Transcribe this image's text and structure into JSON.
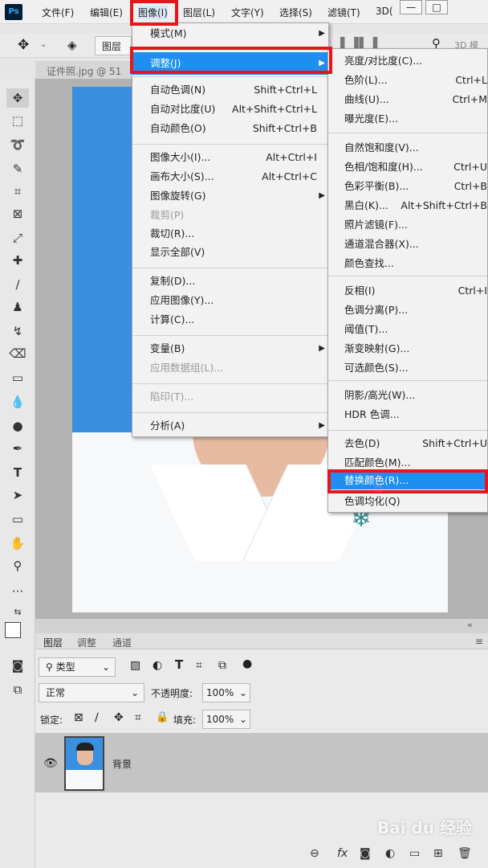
{
  "app": {
    "logo": "Ps"
  },
  "menubar": {
    "file": "文件(F)",
    "edit": "编辑(E)",
    "image": "图像(I)",
    "layer": "图层(L)",
    "type": "文字(Y)",
    "select": "选择(S)",
    "filter": "滤镜(T)",
    "view3d": "3D("
  },
  "window_controls": {
    "minimize": "—",
    "maximize": "□"
  },
  "options_bar": {
    "layer_dropdown": "图层",
    "mode3d": "3D 模"
  },
  "document_tab": {
    "title": "证件照.jpg @ 51"
  },
  "image_menu": {
    "items": [
      {
        "label": "模式(M)",
        "shortcut": "",
        "submenu": true,
        "disabled": false
      },
      {
        "label": "调整(J)",
        "shortcut": "",
        "submenu": true,
        "disabled": false,
        "highlighted": true
      },
      {
        "label": "自动色调(N)",
        "shortcut": "Shift+Ctrl+L",
        "submenu": false,
        "disabled": false
      },
      {
        "label": "自动对比度(U)",
        "shortcut": "Alt+Shift+Ctrl+L",
        "submenu": false,
        "disabled": false
      },
      {
        "label": "自动颜色(O)",
        "shortcut": "Shift+Ctrl+B",
        "submenu": false,
        "disabled": false
      },
      {
        "label": "图像大小(I)...",
        "shortcut": "Alt+Ctrl+I",
        "submenu": false,
        "disabled": false
      },
      {
        "label": "画布大小(S)...",
        "shortcut": "Alt+Ctrl+C",
        "submenu": false,
        "disabled": false
      },
      {
        "label": "图像旋转(G)",
        "shortcut": "",
        "submenu": true,
        "disabled": false
      },
      {
        "label": "裁剪(P)",
        "shortcut": "",
        "submenu": false,
        "disabled": true
      },
      {
        "label": "裁切(R)...",
        "shortcut": "",
        "submenu": false,
        "disabled": false
      },
      {
        "label": "显示全部(V)",
        "shortcut": "",
        "submenu": false,
        "disabled": false
      },
      {
        "label": "复制(D)...",
        "shortcut": "",
        "submenu": false,
        "disabled": false
      },
      {
        "label": "应用图像(Y)...",
        "shortcut": "",
        "submenu": false,
        "disabled": false
      },
      {
        "label": "计算(C)...",
        "shortcut": "",
        "submenu": false,
        "disabled": false
      },
      {
        "label": "变量(B)",
        "shortcut": "",
        "submenu": true,
        "disabled": false
      },
      {
        "label": "应用数据组(L)...",
        "shortcut": "",
        "submenu": false,
        "disabled": true
      },
      {
        "label": "陷印(T)...",
        "shortcut": "",
        "submenu": false,
        "disabled": true
      },
      {
        "label": "分析(A)",
        "shortcut": "",
        "submenu": true,
        "disabled": false
      }
    ]
  },
  "adjust_menu": {
    "items": [
      {
        "label": "亮度/对比度(C)...",
        "shortcut": ""
      },
      {
        "label": "色阶(L)...",
        "shortcut": "Ctrl+L"
      },
      {
        "label": "曲线(U)...",
        "shortcut": "Ctrl+M"
      },
      {
        "label": "曝光度(E)...",
        "shortcut": ""
      },
      {
        "label": "自然饱和度(V)...",
        "shortcut": ""
      },
      {
        "label": "色相/饱和度(H)...",
        "shortcut": "Ctrl+U"
      },
      {
        "label": "色彩平衡(B)...",
        "shortcut": "Ctrl+B"
      },
      {
        "label": "黑白(K)...",
        "shortcut": "Alt+Shift+Ctrl+B"
      },
      {
        "label": "照片滤镜(F)...",
        "shortcut": ""
      },
      {
        "label": "通道混合器(X)...",
        "shortcut": ""
      },
      {
        "label": "颜色查找...",
        "shortcut": ""
      },
      {
        "label": "反相(I)",
        "shortcut": "Ctrl+I"
      },
      {
        "label": "色调分离(P)...",
        "shortcut": ""
      },
      {
        "label": "阈值(T)...",
        "shortcut": ""
      },
      {
        "label": "渐变映射(G)...",
        "shortcut": ""
      },
      {
        "label": "可选颜色(S)...",
        "shortcut": ""
      },
      {
        "label": "阴影/高光(W)...",
        "shortcut": ""
      },
      {
        "label": "HDR 色调...",
        "shortcut": ""
      },
      {
        "label": "去色(D)",
        "shortcut": "Shift+Ctrl+U"
      },
      {
        "label": "匹配颜色(M)...",
        "shortcut": ""
      },
      {
        "label": "替换颜色(R)...",
        "shortcut": "",
        "highlighted": true
      },
      {
        "label": "色调均化(Q)",
        "shortcut": ""
      }
    ]
  },
  "layers_panel": {
    "tabs": [
      "图层",
      "调整",
      "通道"
    ],
    "filter_kind": "类型",
    "blend_mode": "正常",
    "opacity_label": "不透明度:",
    "opacity_value": "100%",
    "lock_label": "锁定:",
    "fill_label": "填充:",
    "fill_value": "100%",
    "layer_name": "背景"
  },
  "watermark": {
    "text": "Bai du 经验"
  },
  "colors": {
    "highlight": "#1e8ef0",
    "annotation_red": "#e8141c",
    "photo_bg_blue": "#3a8fe0"
  }
}
